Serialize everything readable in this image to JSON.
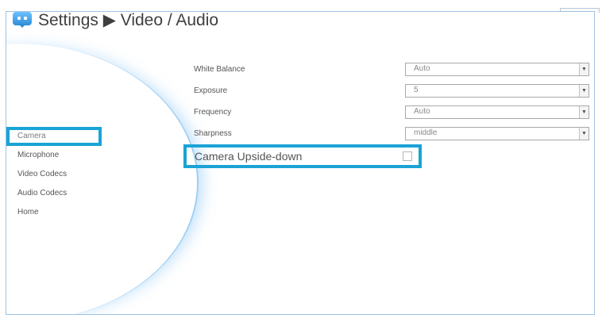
{
  "header": {
    "title": "Settings ▶ Video / Audio",
    "icon": "chat-bubble-icon",
    "accent_color": "#1aa3d6"
  },
  "sidebar": {
    "items": [
      {
        "label": "Camera",
        "active": true
      },
      {
        "label": "Microphone",
        "active": false
      },
      {
        "label": "Video Codecs",
        "active": false
      },
      {
        "label": "Audio Codecs",
        "active": false
      },
      {
        "label": "Home",
        "active": false
      }
    ]
  },
  "settings": {
    "white_balance": {
      "label": "White Balance",
      "value": "Auto"
    },
    "exposure": {
      "label": "Exposure",
      "value": "5"
    },
    "frequency": {
      "label": "Frequency",
      "value": "Auto"
    },
    "sharpness": {
      "label": "Sharpness",
      "value": "middle"
    },
    "upside_down": {
      "label": "Camera Upside-down",
      "checked": false
    }
  }
}
